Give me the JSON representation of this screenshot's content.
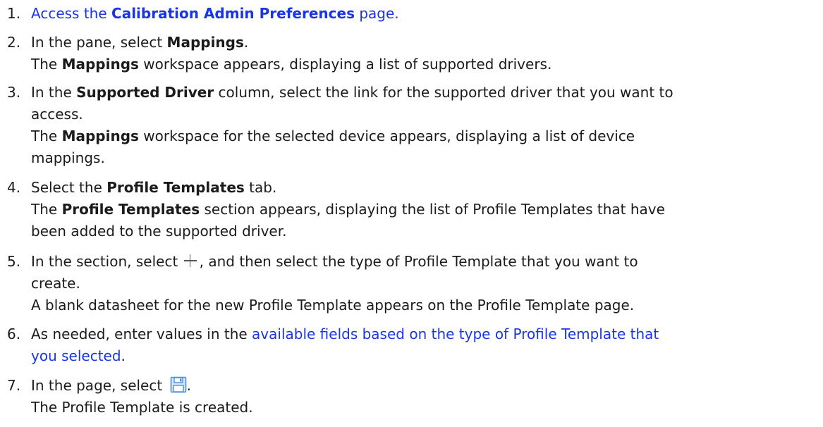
{
  "steps": [
    {
      "num": "1.",
      "pre": "Access the ",
      "bold": "Calibration Admin Preferences",
      "post": " page."
    },
    {
      "num": "2.",
      "l1_pre": "In the pane, select ",
      "l1_bold": "Mappings",
      "l1_post": ".",
      "l2_pre": "The ",
      "l2_bold": "Mappings",
      "l2_post": " workspace appears, displaying a list of supported drivers."
    },
    {
      "num": "3.",
      "l1_pre": "In the ",
      "l1_bold": "Supported Driver",
      "l1_post": " column, select the link for the supported driver that you want to",
      "l2": "access.",
      "l3_pre": "The ",
      "l3_bold": "Mappings",
      "l3_post": " workspace for the selected device appears, displaying a list of device",
      "l4": "mappings."
    },
    {
      "num": "4.",
      "l1_pre": "Select the ",
      "l1_bold": "Profile Templates",
      "l1_post": " tab.",
      "l2_pre": "The ",
      "l2_bold": "Profile Templates",
      "l2_post": " section appears, displaying the list of Profile Templates that have",
      "l3": "been added to the supported driver."
    },
    {
      "num": "5.",
      "l1_pre": "In the section, select ",
      "l1_post": ", and then select the type of Profile Template that you want to",
      "l2": "create.",
      "l3": "A blank datasheet for the new Profile Template appears on the Profile Template page."
    },
    {
      "num": "6.",
      "l1_pre": "As needed, enter values in the ",
      "l1_link": "available fields based on the type of Profile Template that",
      "l2_link": "you selected",
      "l2_post": "."
    },
    {
      "num": "7.",
      "l1_pre": "In the page, select ",
      "l1_post": ".",
      "l2": "The Profile Template is created."
    }
  ],
  "icons": {
    "plus": "plus-icon",
    "save": "save-icon"
  },
  "colors": {
    "link": "#1a35e6",
    "text": "#1b1b1b",
    "save_icon": "#4a90d9"
  }
}
